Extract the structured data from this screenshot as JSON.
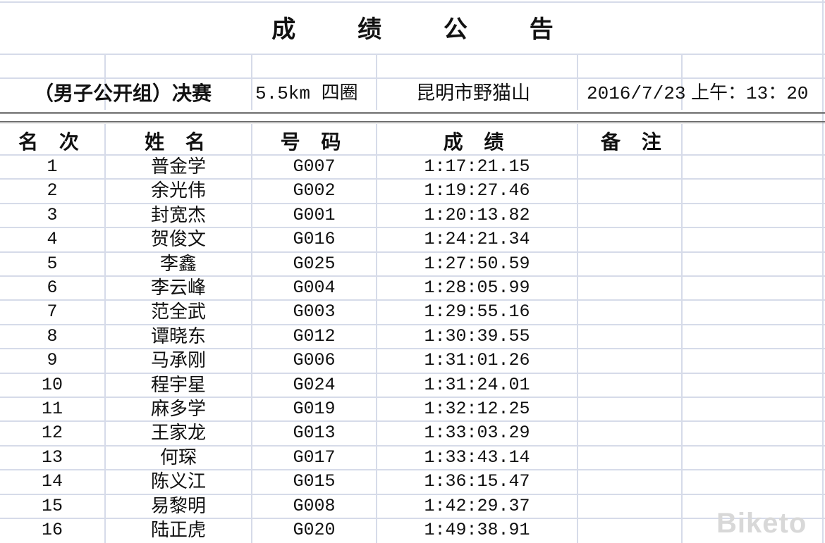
{
  "title": "成 绩 公 告",
  "info": {
    "event": "（男子公开组）决赛",
    "distance": "5.5km  四圈",
    "venue": "昆明市野猫山",
    "date": "2016/7/23",
    "time": "上午：13：20"
  },
  "headers": [
    "名 次",
    "姓 名",
    "号 码",
    "成 绩",
    "备 注"
  ],
  "rows": [
    {
      "rank": "1",
      "name": "普金学",
      "code": "G007",
      "time": "1:17:21.15"
    },
    {
      "rank": "2",
      "name": "余光伟",
      "code": "G002",
      "time": "1:19:27.46"
    },
    {
      "rank": "3",
      "name": "封宽杰",
      "code": "G001",
      "time": "1:20:13.82"
    },
    {
      "rank": "4",
      "name": "贺俊文",
      "code": "G016",
      "time": "1:24:21.34"
    },
    {
      "rank": "5",
      "name": "李鑫",
      "code": "G025",
      "time": "1:27:50.59"
    },
    {
      "rank": "6",
      "name": "李云峰",
      "code": "G004",
      "time": "1:28:05.99"
    },
    {
      "rank": "7",
      "name": "范全武",
      "code": "G003",
      "time": "1:29:55.16"
    },
    {
      "rank": "8",
      "name": "谭晓东",
      "code": "G012",
      "time": "1:30:39.55"
    },
    {
      "rank": "9",
      "name": "马承刚",
      "code": "G006",
      "time": "1:31:01.26"
    },
    {
      "rank": "10",
      "name": "程宇星",
      "code": "G024",
      "time": "1:31:24.01"
    },
    {
      "rank": "11",
      "name": "麻多学",
      "code": "G019",
      "time": "1:32:12.25"
    },
    {
      "rank": "12",
      "name": "王家龙",
      "code": "G013",
      "time": "1:33:03.29"
    },
    {
      "rank": "13",
      "name": "何琛",
      "code": "G017",
      "time": "1:33:43.14"
    },
    {
      "rank": "14",
      "name": "陈义江",
      "code": "G015",
      "time": "1:36:15.47"
    },
    {
      "rank": "15",
      "name": "易黎明",
      "code": "G008",
      "time": "1:42:29.37"
    },
    {
      "rank": "16",
      "name": "陆正虎",
      "code": "G020",
      "time": "1:49:38.91"
    }
  ],
  "watermark": "Biketo"
}
